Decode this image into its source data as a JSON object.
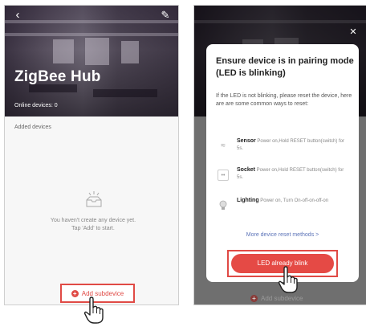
{
  "left_screen": {
    "title": "ZigBee Hub",
    "online_devices": "Online devices: 0",
    "added_devices_label": "Added devices",
    "empty_line1": "You haven't create any device yet.",
    "empty_line2": "Tap 'Add' to start.",
    "add_subdevice_label": "Add subdevice",
    "back_icon": "chevron-left-icon",
    "edit_icon": "pencil-icon"
  },
  "right_screen": {
    "close_icon": "close-icon",
    "modal_title": "Ensure device is in pairing mode (LED is blinking)",
    "modal_description": "If the LED is not blinking, please reset the device, here are are some common ways to reset:",
    "methods": [
      {
        "name": "Sensor",
        "detail": "Power on,Hold RESET button(switch) for 5s.",
        "icon": "sensor-icon"
      },
      {
        "name": "Socket",
        "detail": "Power on,Hold RESET button(switch) for 5s.",
        "icon": "socket-icon"
      },
      {
        "name": "Lighting",
        "detail": "Power on, Turn On-off-on-off-on",
        "icon": "bulb-icon"
      }
    ],
    "more_methods_link": "More device reset methods >",
    "led_button_label": "LED already blink",
    "background_add_label": "Add subdevice"
  },
  "colors": {
    "accent": "#e04a45",
    "link": "#5b73b8"
  }
}
